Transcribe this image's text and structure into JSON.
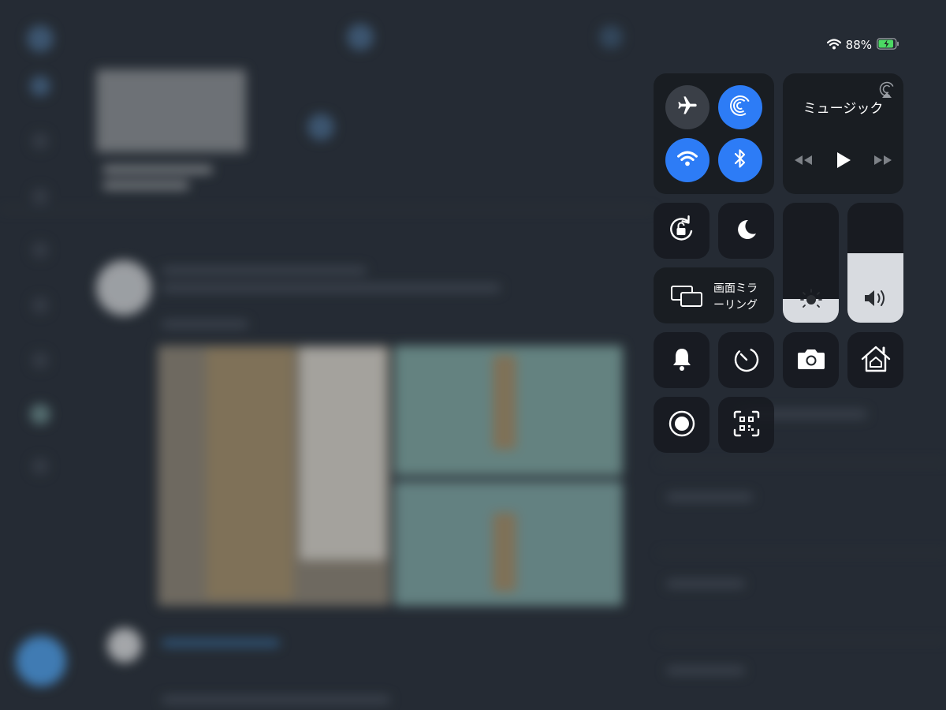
{
  "status_bar": {
    "battery_percent": "88%",
    "battery_level": 0.88,
    "icons": [
      "wifi-icon",
      "battery-charging-icon"
    ]
  },
  "connectivity": {
    "airplane_mode": {
      "icon": "airplane-icon",
      "on": false
    },
    "airdrop": {
      "icon": "airdrop-icon",
      "on": true
    },
    "wifi": {
      "icon": "wifi-icon",
      "on": true
    },
    "bluetooth": {
      "icon": "bluetooth-icon",
      "on": true
    }
  },
  "music": {
    "title": "ミュージック",
    "icons": [
      "airplay-icon",
      "rewind-icon",
      "play-icon",
      "fast-forward-icon"
    ]
  },
  "screen_mirroring": {
    "label_line1": "画面ミラ",
    "label_line2": "ーリング",
    "icon": "screen-mirroring-icon"
  },
  "sliders": {
    "brightness": {
      "level": 0.2,
      "icon": "brightness-icon"
    },
    "volume": {
      "level": 0.58,
      "icon": "speaker-icon"
    }
  },
  "controls": [
    "orientation-lock-icon",
    "do-not-disturb-icon",
    "silent-mode-bell-icon",
    "timer-icon",
    "camera-icon",
    "home-icon",
    "screen-recording-icon",
    "qr-code-scanner-icon"
  ],
  "colors": {
    "accent_blue": "#2d7cf6",
    "tile_bg": "#16191e",
    "off_circle": "#3a3f47",
    "battery_green": "#4cd964",
    "slider_fill": "#d8dbe0"
  }
}
